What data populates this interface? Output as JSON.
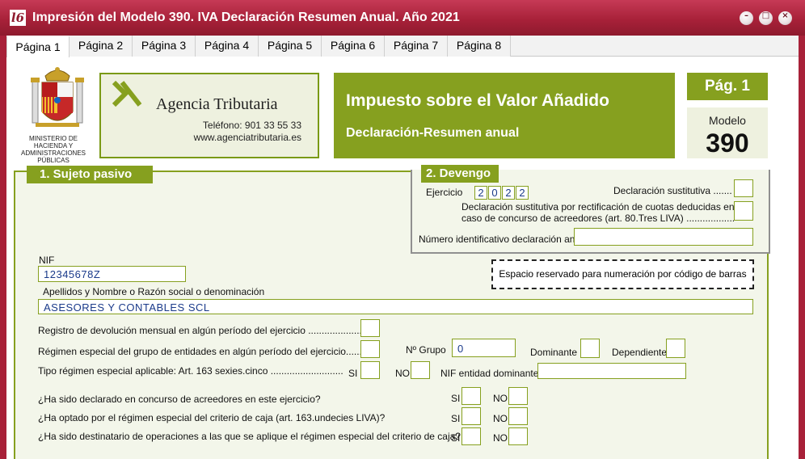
{
  "window": {
    "title": "Impresión del Modelo 390. IVA Declaración Resumen Anual. Año 2021",
    "app_icon": "l6",
    "controls": {
      "minimize": "–",
      "maximize": "□",
      "close": "×"
    }
  },
  "tabs": [
    "Página 1",
    "Página 2",
    "Página 3",
    "Página 4",
    "Página 5",
    "Página 6",
    "Página 7",
    "Página 8"
  ],
  "active_tab": "Página 1",
  "header": {
    "ministry": "MINISTERIO DE HACIENDA Y ADMINISTRACIONES PÚBLICAS",
    "agency": {
      "name": "Agencia Tributaria",
      "phone": "Teléfono: 901 33 55 33",
      "web": "www.agenciatributaria.es"
    },
    "tax_title": "Impuesto sobre el Valor Añadido",
    "tax_subtitle": "Declaración-Resumen anual",
    "page_label": "Pág. 1",
    "modelo_label": "Modelo",
    "modelo_number": "390"
  },
  "sujeto_pasivo": {
    "heading": "1. Sujeto pasivo",
    "nif_label": "NIF",
    "nif_value": "12345678Z",
    "name_label": "Apellidos y Nombre o Razón social o denominación",
    "name_value": "ASESORES Y CONTABLES SCL",
    "barcode_text": "Espacio reservado para numeración por código de barras",
    "registro_devolucion": "Registro de devolución mensual en algún período del ejercicio ....................",
    "regimen_grupo": "Régimen especial del grupo de entidades en algún período del ejercicio.......",
    "n_grupo_label": "Nº Grupo",
    "n_grupo_value": "0",
    "dominante": "Dominante",
    "dependiente": "Dependiente",
    "tipo_regimen": "Tipo régimen especial aplicable: Art. 163 sexies.cinco ...........................",
    "si": "SI",
    "no": "NO",
    "nif_entidad": "NIF entidad dominante",
    "q_concurso": "¿Ha sido declarado en concurso de acreedores en este ejercicio?",
    "q_criterio_caja": "¿Ha optado por el régimen especial del criterio de caja (art. 163.undecies LIVA)?",
    "q_destinatario": "¿Ha sido destinatario de operaciones a las que se aplique el régimen especial del criterio de caja?"
  },
  "devengo": {
    "heading": "2. Devengo",
    "ejercicio_label": "Ejercicio",
    "ejercicio_digits": [
      "2",
      "0",
      "2",
      "2"
    ],
    "sustitutiva": "Declaración sustitutiva .......",
    "sustitutiva_rect_1": "Declaración sustitutiva por rectificación de cuotas deducidas en",
    "sustitutiva_rect_2": "caso de concurso de acreedores (art. 80.Tres LIVA) ..................",
    "num_anterior": "Número identificativo declaración anterior"
  },
  "colors": {
    "accent": "#86a01f",
    "titlebar": "#a82139",
    "value_text": "#1a3a8a"
  }
}
